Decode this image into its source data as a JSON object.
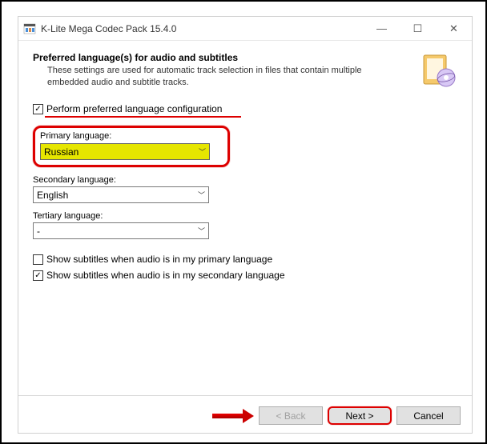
{
  "window": {
    "title": "K-Lite Mega Codec Pack 15.4.0"
  },
  "page": {
    "heading": "Preferred language(s) for audio and subtitles",
    "subtext": "These settings are used for automatic track selection in files that contain multiple embedded audio and subtitle tracks."
  },
  "options": {
    "perform_config_label": "Perform preferred language configuration",
    "perform_config_checked": true,
    "primary_label": "Primary language:",
    "primary_value": "Russian",
    "secondary_label": "Secondary language:",
    "secondary_value": "English",
    "tertiary_label": "Tertiary language:",
    "tertiary_value": "-",
    "show_sub_primary_label": "Show subtitles when audio is in my primary language",
    "show_sub_primary_checked": false,
    "show_sub_secondary_label": "Show subtitles when audio is in my secondary language",
    "show_sub_secondary_checked": true
  },
  "footer": {
    "back_label": "< Back",
    "next_label": "Next >",
    "cancel_label": "Cancel"
  }
}
